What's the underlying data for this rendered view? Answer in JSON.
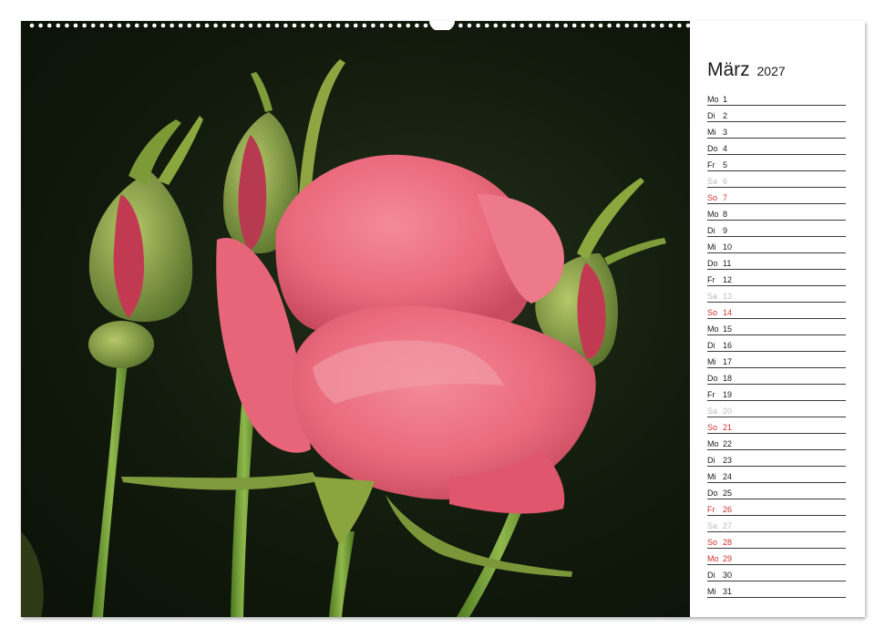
{
  "calendar": {
    "month": "März",
    "year": "2027",
    "days": [
      {
        "weekday": "Mo",
        "day": "1",
        "type": "weekday"
      },
      {
        "weekday": "Di",
        "day": "2",
        "type": "weekday"
      },
      {
        "weekday": "Mi",
        "day": "3",
        "type": "weekday"
      },
      {
        "weekday": "Do",
        "day": "4",
        "type": "weekday"
      },
      {
        "weekday": "Fr",
        "day": "5",
        "type": "weekday"
      },
      {
        "weekday": "Sa",
        "day": "6",
        "type": "saturday"
      },
      {
        "weekday": "So",
        "day": "7",
        "type": "sunday"
      },
      {
        "weekday": "Mo",
        "day": "8",
        "type": "weekday"
      },
      {
        "weekday": "Di",
        "day": "9",
        "type": "weekday"
      },
      {
        "weekday": "Mi",
        "day": "10",
        "type": "weekday"
      },
      {
        "weekday": "Do",
        "day": "11",
        "type": "weekday"
      },
      {
        "weekday": "Fr",
        "day": "12",
        "type": "weekday"
      },
      {
        "weekday": "Sa",
        "day": "13",
        "type": "saturday"
      },
      {
        "weekday": "So",
        "day": "14",
        "type": "sunday"
      },
      {
        "weekday": "Mo",
        "day": "15",
        "type": "weekday"
      },
      {
        "weekday": "Di",
        "day": "16",
        "type": "weekday"
      },
      {
        "weekday": "Mi",
        "day": "17",
        "type": "weekday"
      },
      {
        "weekday": "Do",
        "day": "18",
        "type": "weekday"
      },
      {
        "weekday": "Fr",
        "day": "19",
        "type": "weekday"
      },
      {
        "weekday": "Sa",
        "day": "20",
        "type": "saturday"
      },
      {
        "weekday": "So",
        "day": "21",
        "type": "sunday"
      },
      {
        "weekday": "Mo",
        "day": "22",
        "type": "weekday"
      },
      {
        "weekday": "Di",
        "day": "23",
        "type": "weekday"
      },
      {
        "weekday": "Mi",
        "day": "24",
        "type": "weekday"
      },
      {
        "weekday": "Do",
        "day": "25",
        "type": "weekday"
      },
      {
        "weekday": "Fr",
        "day": "26",
        "type": "sunday"
      },
      {
        "weekday": "Sa",
        "day": "27",
        "type": "saturday"
      },
      {
        "weekday": "So",
        "day": "28",
        "type": "sunday"
      },
      {
        "weekday": "Mo",
        "day": "29",
        "type": "sunday"
      },
      {
        "weekday": "Di",
        "day": "30",
        "type": "weekday"
      },
      {
        "weekday": "Mi",
        "day": "31",
        "type": "weekday"
      }
    ]
  },
  "photo": {
    "subject": "pink-rose-with-buds-icon"
  },
  "colors": {
    "weekday": "#1a1a1a",
    "saturday": "#bbbbbb",
    "holiday": "#d0312d",
    "rose": "#ef6f80",
    "background": "#111a0c"
  }
}
